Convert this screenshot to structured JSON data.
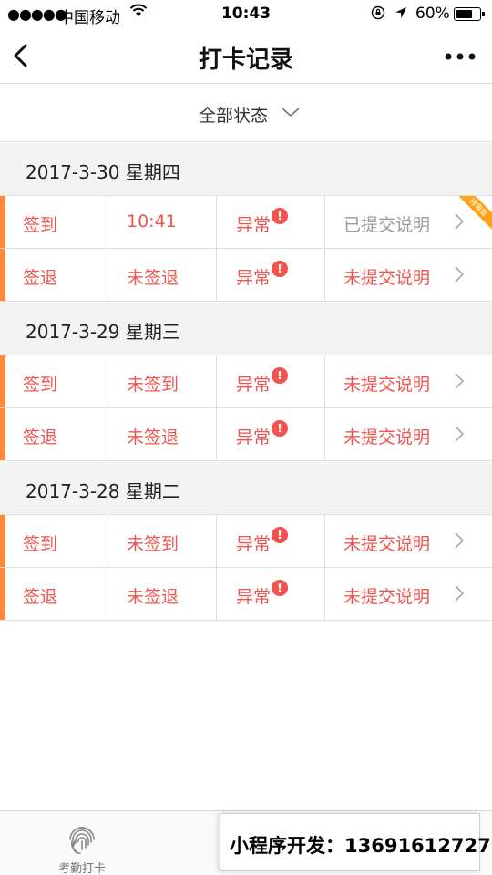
{
  "status_bar": {
    "signal_dots": "●●●●●",
    "carrier": "中国移动",
    "time": "10:43",
    "battery_percent": "60%"
  },
  "nav": {
    "title": "打卡记录"
  },
  "filter": {
    "label": "全部状态"
  },
  "days": [
    {
      "date": "2017-3-30 星期四",
      "records": [
        {
          "type": "签到",
          "time": "10:41",
          "status": "异常",
          "note": "已提交说明",
          "note_muted": true,
          "ribbon": "待审批"
        },
        {
          "type": "签退",
          "time": "未签退",
          "status": "异常",
          "note": "未提交说明",
          "note_muted": false
        }
      ]
    },
    {
      "date": "2017-3-29 星期三",
      "records": [
        {
          "type": "签到",
          "time": "未签到",
          "status": "异常",
          "note": "未提交说明",
          "note_muted": false
        },
        {
          "type": "签退",
          "time": "未签退",
          "status": "异常",
          "note": "未提交说明",
          "note_muted": false
        }
      ]
    },
    {
      "date": "2017-3-28 星期二",
      "records": [
        {
          "type": "签到",
          "time": "未签到",
          "status": "异常",
          "note": "未提交说明",
          "note_muted": false
        },
        {
          "type": "签退",
          "time": "未签退",
          "status": "异常",
          "note": "未提交说明",
          "note_muted": false
        }
      ]
    }
  ],
  "tab_bar": {
    "tabs": [
      {
        "label": "考勤打卡",
        "icon": "fingerprint-icon"
      }
    ]
  },
  "promo": {
    "text": "小程序开发：13691612727"
  },
  "colors": {
    "accent_bar": "#ff8a3d",
    "alert_text": "#f0544f",
    "muted_text": "#9b9b9b",
    "ribbon": "#ffa21a"
  }
}
